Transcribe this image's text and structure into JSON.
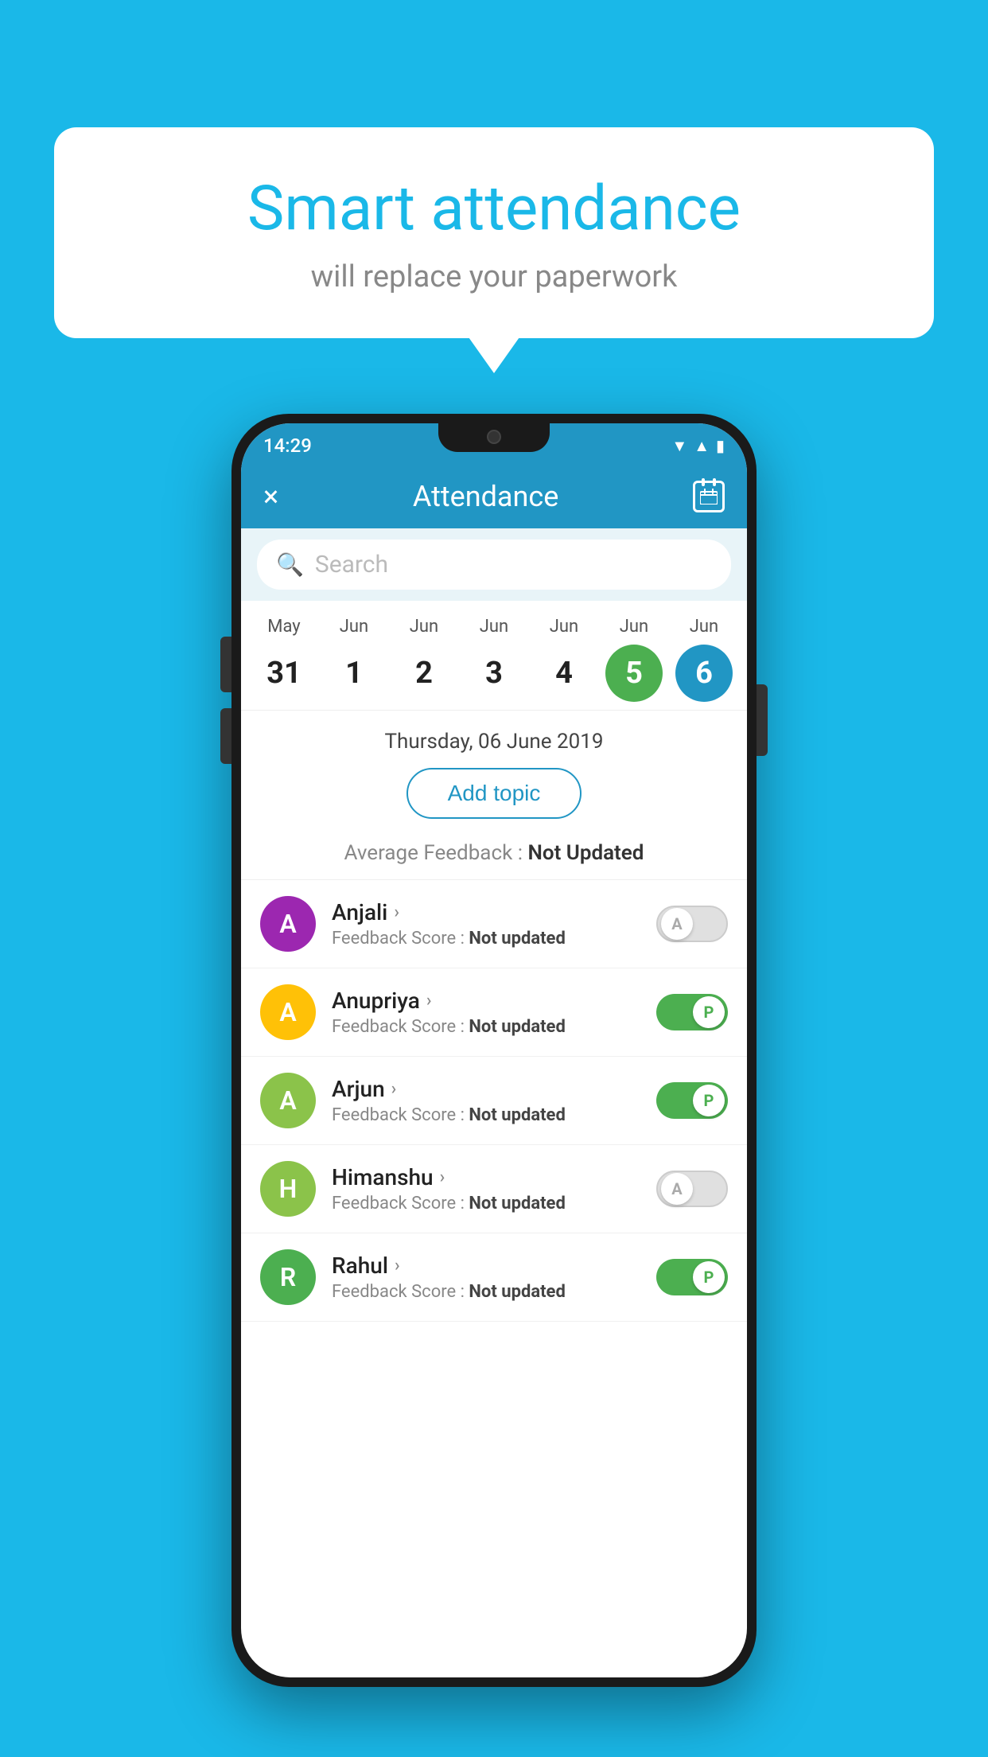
{
  "background_color": "#1ab8e8",
  "speech_bubble": {
    "title": "Smart attendance",
    "subtitle": "will replace your paperwork"
  },
  "status_bar": {
    "time": "14:29",
    "wifi_icon": "▲",
    "signal_icon": "▲",
    "battery_icon": "▮"
  },
  "app_bar": {
    "close_label": "×",
    "title": "Attendance",
    "calendar_icon": "calendar"
  },
  "search": {
    "placeholder": "Search"
  },
  "calendar": {
    "days": [
      {
        "month": "May",
        "date": "31",
        "state": "normal"
      },
      {
        "month": "Jun",
        "date": "1",
        "state": "normal"
      },
      {
        "month": "Jun",
        "date": "2",
        "state": "normal"
      },
      {
        "month": "Jun",
        "date": "3",
        "state": "normal"
      },
      {
        "month": "Jun",
        "date": "4",
        "state": "normal"
      },
      {
        "month": "Jun",
        "date": "5",
        "state": "today"
      },
      {
        "month": "Jun",
        "date": "6",
        "state": "selected"
      }
    ]
  },
  "selected_date": "Thursday, 06 June 2019",
  "add_topic_label": "Add topic",
  "average_feedback": {
    "label": "Average Feedback :",
    "value": "Not Updated"
  },
  "students": [
    {
      "name": "Anjali",
      "avatar_letter": "A",
      "avatar_color": "#9c27b0",
      "feedback_label": "Feedback Score :",
      "feedback_value": "Not updated",
      "toggle": "off",
      "toggle_label": "A"
    },
    {
      "name": "Anupriya",
      "avatar_letter": "A",
      "avatar_color": "#ffc107",
      "feedback_label": "Feedback Score :",
      "feedback_value": "Not updated",
      "toggle": "on",
      "toggle_label": "P"
    },
    {
      "name": "Arjun",
      "avatar_letter": "A",
      "avatar_color": "#8bc34a",
      "feedback_label": "Feedback Score :",
      "feedback_value": "Not updated",
      "toggle": "on",
      "toggle_label": "P"
    },
    {
      "name": "Himanshu",
      "avatar_letter": "H",
      "avatar_color": "#8bc34a",
      "feedback_label": "Feedback Score :",
      "feedback_value": "Not updated",
      "toggle": "off",
      "toggle_label": "A"
    },
    {
      "name": "Rahul",
      "avatar_letter": "R",
      "avatar_color": "#4caf50",
      "feedback_label": "Feedback Score :",
      "feedback_value": "Not updated",
      "toggle": "on",
      "toggle_label": "P"
    }
  ]
}
